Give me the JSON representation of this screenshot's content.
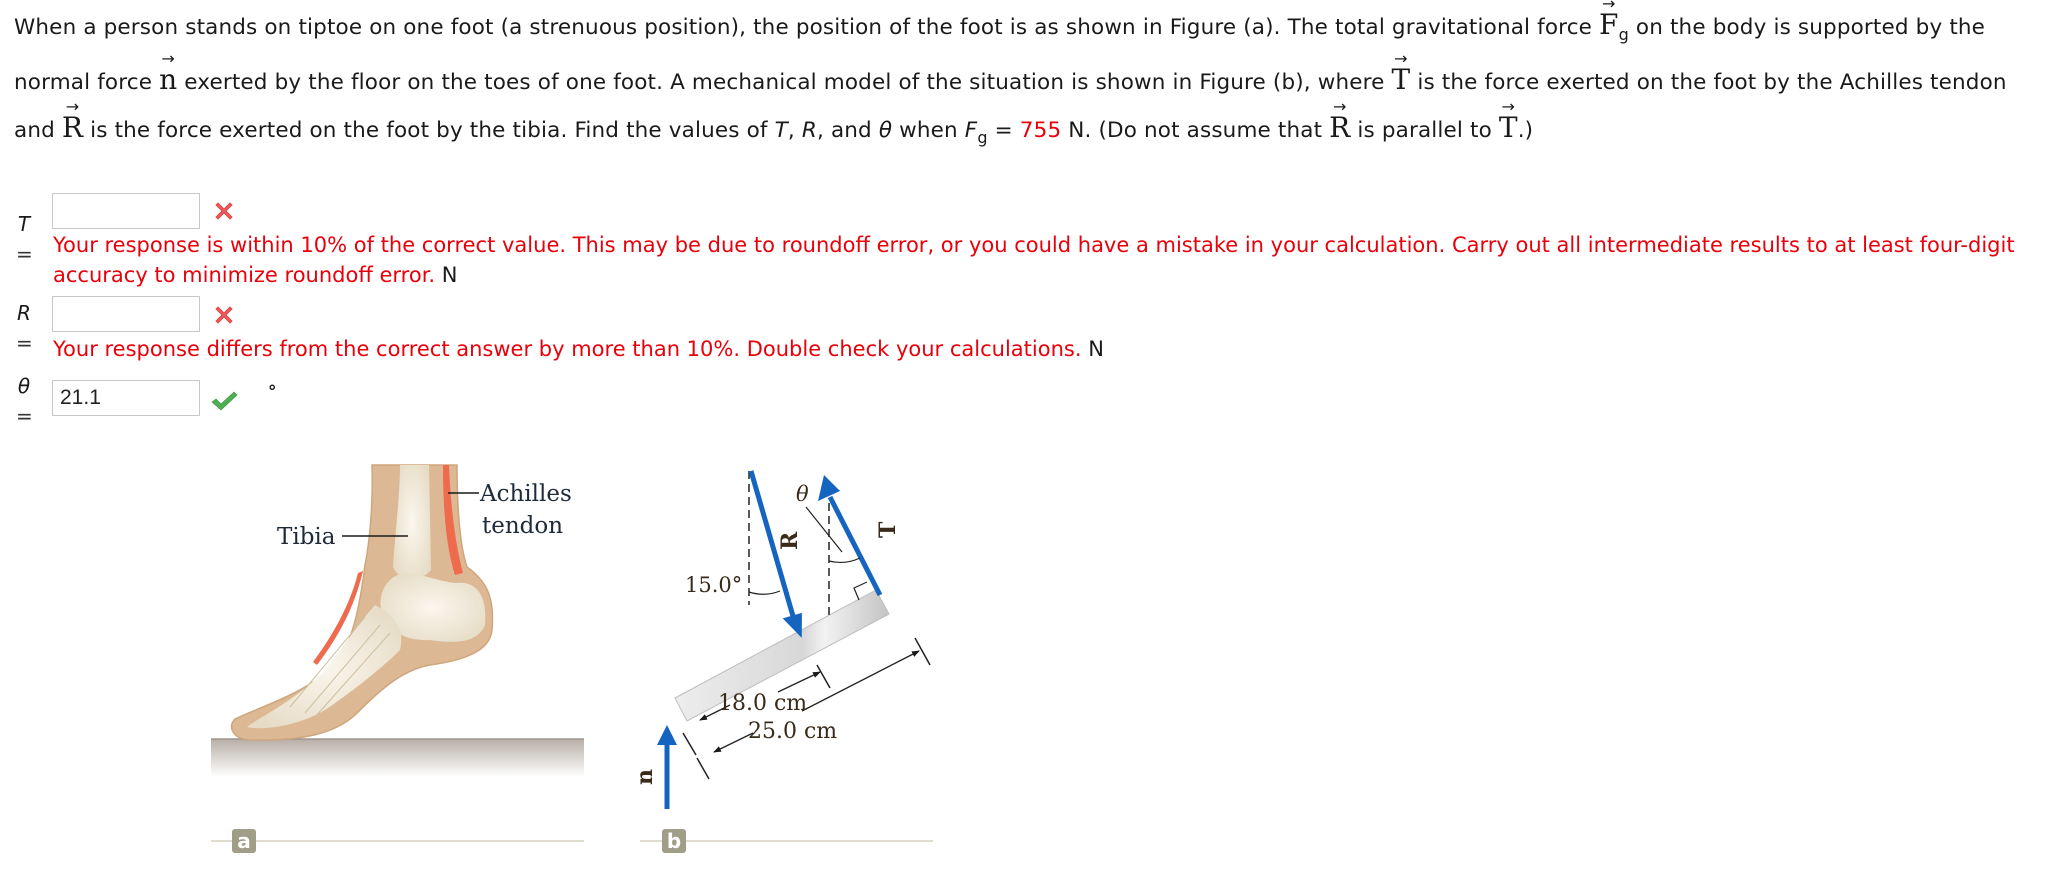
{
  "problem": {
    "p1": "When a person stands on tiptoe on one foot (a strenuous position), the position of the foot is as shown in Figure (a). The total gravitational force ",
    "vec_F": "F",
    "sub_g": "g",
    "p2": " on the body is supported by the normal force ",
    "vec_n": "n",
    "p3": " exerted by the floor on the toes of one foot. A mechanical model of the situation is shown in Figure (b), where ",
    "vec_T": "T",
    "p4": " is the force exerted on the foot by the Achilles tendon and ",
    "vec_R": "R",
    "p5": " is the force exerted on the foot by the tibia. Find the values of ",
    "var_T": "T",
    "comma1": ", ",
    "var_R": "R",
    "and": ", and ",
    "var_theta": "θ",
    "when": " when ",
    "var_F": "F",
    "eq": " = ",
    "value_Fg": "755",
    "p6": " N. (Do not assume that ",
    "vec_R2": "R",
    "p7": " is parallel to ",
    "vec_T2": "T",
    "p8": ".)",
    "arrow": "→"
  },
  "answers": [
    {
      "label": "T",
      "equals": "=",
      "value": "",
      "status": "incorrect",
      "feedback": "Your response is within 10% of the correct value. This may be due to roundoff error, or you could have a mistake in your calculation. Carry out all intermediate results to at least four-digit accuracy to minimize roundoff error.",
      "unit": "N"
    },
    {
      "label": "R",
      "equals": "=",
      "value": "",
      "status": "incorrect",
      "feedback": "Your response differs from the correct answer by more than 10%. Double check your calculations.",
      "unit": "N"
    },
    {
      "label": "θ",
      "equals": "=",
      "value": "21.1",
      "status": "correct",
      "feedback": "",
      "unit": "°"
    }
  ],
  "figure_a": {
    "label_tibia": "Tibia",
    "label_achilles_1": "Achilles",
    "label_achilles_2": "tendon",
    "badge": "a"
  },
  "figure_b": {
    "vec_R": "R",
    "vec_T": "T",
    "vec_n": "n",
    "theta": "θ",
    "angle": "15.0°",
    "dist_short": "18.0 cm",
    "dist_long": "25.0 cm",
    "badge": "b"
  },
  "colors": {
    "error_red": "#e8000b",
    "correct_green": "#4caf50",
    "vector_blue": "#1565c0",
    "badge": "#a09e86"
  }
}
